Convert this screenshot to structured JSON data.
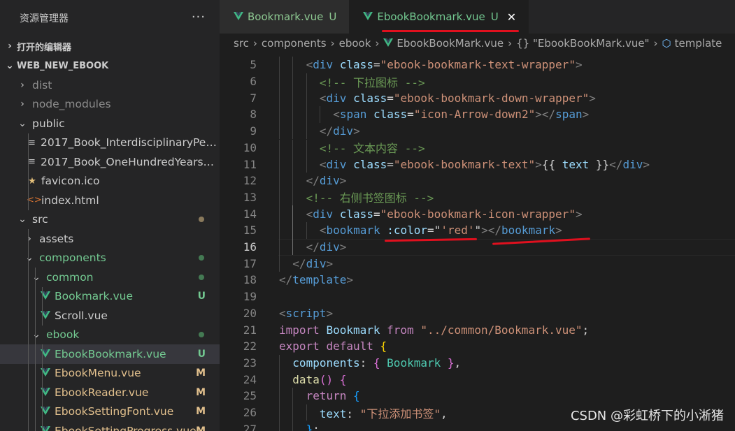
{
  "explorer": {
    "title": "资源管理器",
    "more": "···",
    "open_editors": "打开的编辑器",
    "project": "WEB_NEW_EBOOK",
    "items": [
      {
        "label": "dist",
        "type": "folder",
        "expanded": false,
        "depth": 1,
        "color": "#8c8c8c"
      },
      {
        "label": "node_modules",
        "type": "folder",
        "expanded": false,
        "depth": 1,
        "color": "#8c8c8c"
      },
      {
        "label": "public",
        "type": "folder",
        "expanded": true,
        "depth": 1,
        "color": "#cccccc"
      },
      {
        "label": "2017_Book_InterdisciplinaryPerspe...",
        "type": "file",
        "icon": "≡",
        "depth": 2,
        "color": "#cccccc"
      },
      {
        "label": "2017_Book_OneHundredYearsOfC...",
        "type": "file",
        "icon": "≡",
        "depth": 2,
        "color": "#cccccc"
      },
      {
        "label": "favicon.ico",
        "type": "file",
        "icon": "★",
        "icon_color": "#e5c07b",
        "depth": 2,
        "color": "#cccccc"
      },
      {
        "label": "index.html",
        "type": "file",
        "icon": "<>",
        "icon_color": "#e37933",
        "depth": 2,
        "color": "#cccccc"
      },
      {
        "label": "src",
        "type": "folder",
        "expanded": true,
        "depth": 1,
        "color": "#cccccc",
        "dot": "#8a7a5c"
      },
      {
        "label": "assets",
        "type": "folder",
        "expanded": false,
        "depth": 2,
        "color": "#cccccc"
      },
      {
        "label": "components",
        "type": "folder",
        "expanded": true,
        "depth": 2,
        "color": "#73c991",
        "dot": "#447a53"
      },
      {
        "label": "common",
        "type": "folder",
        "expanded": true,
        "depth": 3,
        "color": "#73c991",
        "dot": "#447a53"
      },
      {
        "label": "Bookmark.vue",
        "type": "file",
        "icon": "vue",
        "depth": 4,
        "color": "#73c991",
        "badge": "U",
        "badge_color": "#73c991"
      },
      {
        "label": "Scroll.vue",
        "type": "file",
        "icon": "vue",
        "depth": 4,
        "color": "#cccccc"
      },
      {
        "label": "ebook",
        "type": "folder",
        "expanded": true,
        "depth": 3,
        "color": "#73c991",
        "dot": "#447a53"
      },
      {
        "label": "EbookBookmark.vue",
        "type": "file",
        "icon": "vue",
        "depth": 4,
        "color": "#73c991",
        "badge": "U",
        "badge_color": "#73c991",
        "selected": true
      },
      {
        "label": "EbookMenu.vue",
        "type": "file",
        "icon": "vue",
        "depth": 4,
        "color": "#e2c08d",
        "badge": "M",
        "badge_color": "#e2c08d"
      },
      {
        "label": "EbookReader.vue",
        "type": "file",
        "icon": "vue",
        "depth": 4,
        "color": "#e2c08d",
        "badge": "M",
        "badge_color": "#e2c08d"
      },
      {
        "label": "EbookSettingFont.vue",
        "type": "file",
        "icon": "vue",
        "depth": 4,
        "color": "#e2c08d",
        "badge": "M",
        "badge_color": "#e2c08d"
      },
      {
        "label": "EbookSettingProgress.vue",
        "type": "file",
        "icon": "vue",
        "depth": 4,
        "color": "#e2c08d",
        "badge": "M",
        "badge_color": "#e2c08d"
      }
    ]
  },
  "tabs": [
    {
      "label": "Bookmark.vue",
      "status": "U",
      "active": false
    },
    {
      "label": "EbookBookmark.vue",
      "status": "U",
      "active": true,
      "close": "✕"
    }
  ],
  "breadcrumb": [
    "src",
    "components",
    "ebook",
    "EbookBookMark.vue",
    "{} \"EbookBookMark.vue\"",
    "template"
  ],
  "editor": {
    "current_line": 16,
    "lines": [
      {
        "n": 5,
        "indent": 2,
        "tokens": [
          [
            "t-br",
            "<"
          ],
          [
            "t-tag",
            "div"
          ],
          [
            "t-plain",
            " "
          ],
          [
            "t-attr",
            "class"
          ],
          [
            "t-plain",
            "="
          ],
          [
            "t-str",
            "\"ebook-bookmark-text-wrapper\""
          ],
          [
            "t-br",
            ">"
          ]
        ]
      },
      {
        "n": 6,
        "indent": 3,
        "tokens": [
          [
            "t-cm",
            "<!-- 下拉图标 -->"
          ]
        ]
      },
      {
        "n": 7,
        "indent": 3,
        "tokens": [
          [
            "t-br",
            "<"
          ],
          [
            "t-tag",
            "div"
          ],
          [
            "t-plain",
            " "
          ],
          [
            "t-attr",
            "class"
          ],
          [
            "t-plain",
            "="
          ],
          [
            "t-str",
            "\"ebook-bookmark-down-wrapper\""
          ],
          [
            "t-br",
            ">"
          ]
        ]
      },
      {
        "n": 8,
        "indent": 4,
        "tokens": [
          [
            "t-br",
            "<"
          ],
          [
            "t-tag",
            "span"
          ],
          [
            "t-plain",
            " "
          ],
          [
            "t-attr",
            "class"
          ],
          [
            "t-plain",
            "="
          ],
          [
            "t-str",
            "\"icon-Arrow-down2\""
          ],
          [
            "t-br",
            "></"
          ],
          [
            "t-tag",
            "span"
          ],
          [
            "t-br",
            ">"
          ]
        ]
      },
      {
        "n": 9,
        "indent": 3,
        "tokens": [
          [
            "t-br",
            "</"
          ],
          [
            "t-tag",
            "div"
          ],
          [
            "t-br",
            ">"
          ]
        ]
      },
      {
        "n": 10,
        "indent": 3,
        "tokens": [
          [
            "t-cm",
            "<!-- 文本内容 -->"
          ]
        ]
      },
      {
        "n": 11,
        "indent": 3,
        "tokens": [
          [
            "t-br",
            "<"
          ],
          [
            "t-tag",
            "div"
          ],
          [
            "t-plain",
            " "
          ],
          [
            "t-attr",
            "class"
          ],
          [
            "t-plain",
            "="
          ],
          [
            "t-str",
            "\"ebook-bookmark-text\""
          ],
          [
            "t-br",
            ">"
          ],
          [
            "t-plain",
            "{{ "
          ],
          [
            "t-attr",
            "text"
          ],
          [
            "t-plain",
            " }}"
          ],
          [
            "t-br",
            "</"
          ],
          [
            "t-tag",
            "div"
          ],
          [
            "t-br",
            ">"
          ]
        ]
      },
      {
        "n": 12,
        "indent": 2,
        "tokens": [
          [
            "t-br",
            "</"
          ],
          [
            "t-tag",
            "div"
          ],
          [
            "t-br",
            ">"
          ]
        ]
      },
      {
        "n": 13,
        "indent": 2,
        "tokens": [
          [
            "t-cm",
            "<!-- 右侧书签图标 -->"
          ]
        ]
      },
      {
        "n": 14,
        "indent": 2,
        "tokens": [
          [
            "t-br",
            "<"
          ],
          [
            "t-tag",
            "div"
          ],
          [
            "t-plain",
            " "
          ],
          [
            "t-attr",
            "class"
          ],
          [
            "t-plain",
            "="
          ],
          [
            "t-str",
            "\"ebook-bookmark-icon-wrapper\""
          ],
          [
            "t-br",
            ">"
          ]
        ]
      },
      {
        "n": 15,
        "indent": 3,
        "tokens": [
          [
            "t-br",
            "<"
          ],
          [
            "t-tag",
            "bookmark"
          ],
          [
            "t-plain",
            " "
          ],
          [
            "t-attr",
            ":color"
          ],
          [
            "t-plain",
            "="
          ],
          [
            "t-plain",
            "\""
          ],
          [
            "t-str",
            "'red'"
          ],
          [
            "t-plain",
            "\""
          ],
          [
            "t-br",
            "></"
          ],
          [
            "t-tag",
            "bookmark"
          ],
          [
            "t-br",
            ">"
          ]
        ]
      },
      {
        "n": 16,
        "indent": 2,
        "tokens": [
          [
            "t-br",
            "</"
          ],
          [
            "t-tag",
            "div"
          ],
          [
            "t-br",
            ">"
          ]
        ]
      },
      {
        "n": 17,
        "indent": 1,
        "tokens": [
          [
            "t-br",
            "</"
          ],
          [
            "t-tag",
            "div"
          ],
          [
            "t-br",
            ">"
          ]
        ]
      },
      {
        "n": 18,
        "indent": 0,
        "tokens": [
          [
            "t-br",
            "</"
          ],
          [
            "t-tag",
            "template"
          ],
          [
            "t-br",
            ">"
          ]
        ]
      },
      {
        "n": 19,
        "indent": 0,
        "tokens": []
      },
      {
        "n": 20,
        "indent": 0,
        "tokens": [
          [
            "t-br",
            "<"
          ],
          [
            "t-tag",
            "script"
          ],
          [
            "t-br",
            ">"
          ]
        ]
      },
      {
        "n": 21,
        "indent": 0,
        "tokens": [
          [
            "t-kw",
            "import"
          ],
          [
            "t-plain",
            " "
          ],
          [
            "t-attr",
            "Bookmark"
          ],
          [
            "t-plain",
            " "
          ],
          [
            "t-kw",
            "from"
          ],
          [
            "t-plain",
            " "
          ],
          [
            "t-str",
            "\"../common/Bookmark.vue\""
          ],
          [
            "t-plain",
            ";"
          ]
        ]
      },
      {
        "n": 22,
        "indent": 0,
        "tokens": [
          [
            "t-kw",
            "export"
          ],
          [
            "t-plain",
            " "
          ],
          [
            "t-kw",
            "default"
          ],
          [
            "t-plain",
            " "
          ],
          [
            "t-brace",
            "{"
          ]
        ]
      },
      {
        "n": 23,
        "indent": 1,
        "tokens": [
          [
            "t-attr",
            "components"
          ],
          [
            "t-plain",
            ": "
          ],
          [
            "t-brace2",
            "{"
          ],
          [
            "t-plain",
            " "
          ],
          [
            "t-comp",
            "Bookmark"
          ],
          [
            "t-plain",
            " "
          ],
          [
            "t-brace2",
            "}"
          ],
          [
            "t-plain",
            ","
          ]
        ]
      },
      {
        "n": 24,
        "indent": 1,
        "tokens": [
          [
            "t-fn",
            "data"
          ],
          [
            "t-brace2",
            "("
          ],
          [
            "t-brace2",
            ")"
          ],
          [
            "t-plain",
            " "
          ],
          [
            "t-brace2",
            "{"
          ]
        ]
      },
      {
        "n": 25,
        "indent": 2,
        "tokens": [
          [
            "t-kw",
            "return"
          ],
          [
            "t-plain",
            " "
          ],
          [
            "t-brace3",
            "{"
          ]
        ]
      },
      {
        "n": 26,
        "indent": 3,
        "tokens": [
          [
            "t-attr",
            "text"
          ],
          [
            "t-plain",
            ": "
          ],
          [
            "t-str",
            "\"下拉添加书签\""
          ],
          [
            "t-plain",
            ","
          ]
        ]
      },
      {
        "n": 27,
        "indent": 2,
        "tokens": [
          [
            "t-brace3",
            "}"
          ],
          [
            "t-plain",
            ";"
          ]
        ]
      }
    ]
  },
  "watermark": "CSDN @彩虹桥下的小淅猪"
}
